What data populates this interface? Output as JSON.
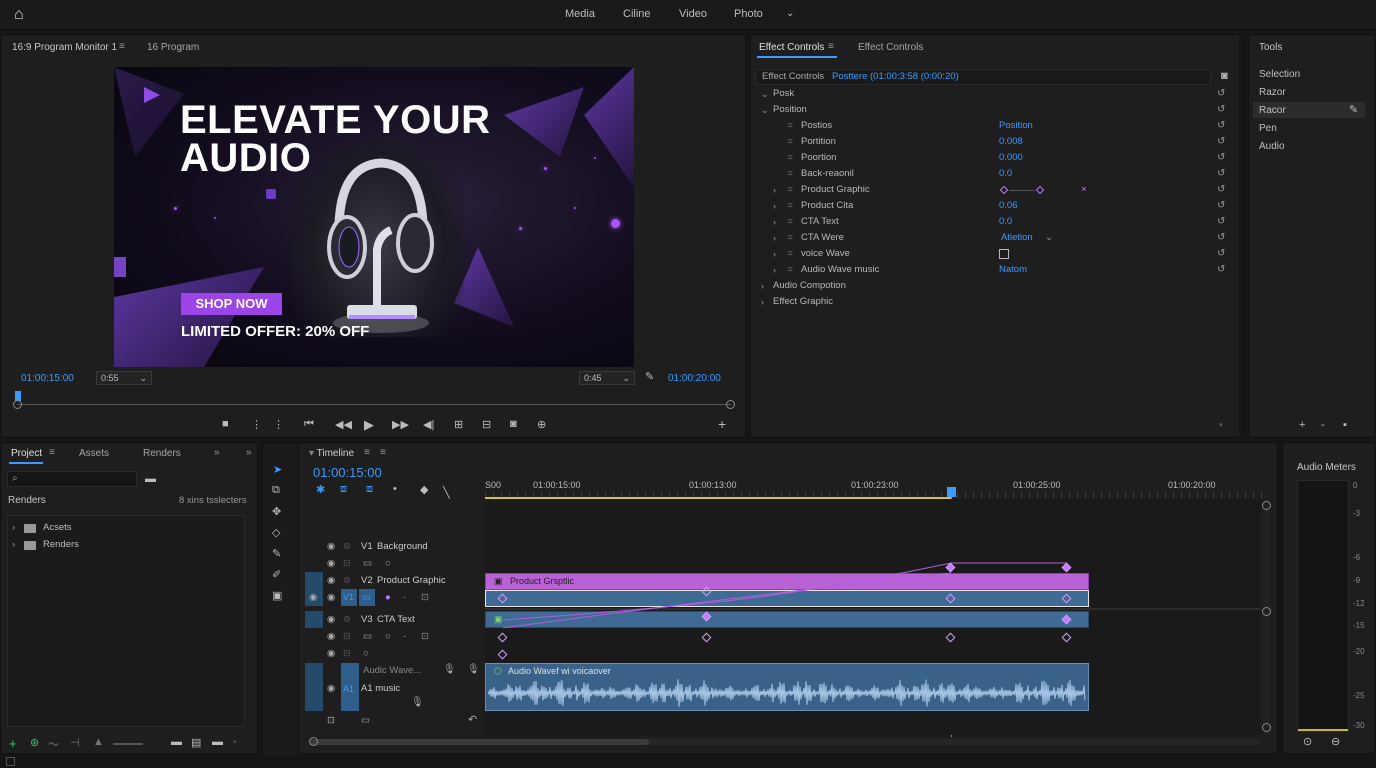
{
  "topbar": {
    "tabs": [
      "Media",
      "Ciline",
      "Video",
      "Photo"
    ]
  },
  "program_monitor": {
    "tab1": "16:9 Program Monitor 1",
    "tab2": "16 Program",
    "timecode_left": "01:00:15:00",
    "zoom_left": "0:55",
    "zoom_right": "0:45",
    "timecode_right": "01:00:20:00",
    "frame": {
      "headline_line1": "ELEVATE YOUR",
      "headline_line2": "AUDIO",
      "cta": "SHOP NOW",
      "offer": "LIMITED OFFER: 20% OFF",
      "accent_color": "#9b45e8"
    }
  },
  "effect_controls": {
    "tab1": "Effect Controls",
    "tab2": "Effect Controls",
    "header_label": "Effect Controls",
    "header_clip": "Posttere (01:00:3:58 (0:00:20)",
    "rows": [
      {
        "label": "Posk"
      },
      {
        "label": "Position"
      },
      {
        "label": "Postios",
        "value": "Position"
      },
      {
        "label": "Portition",
        "value": "0.008"
      },
      {
        "label": "Poortion",
        "value": "0.000"
      },
      {
        "label": "Back-reaonil",
        "value": "0.0"
      },
      {
        "label": "Product Graphic"
      },
      {
        "label": "Product Cita",
        "value": "0.06"
      },
      {
        "label": "CTA Text",
        "value": "0.0"
      },
      {
        "label": "CTA Were",
        "value": "Atietion"
      },
      {
        "label": "voice Wave"
      },
      {
        "label": "Audio Wave music",
        "value": "Natom"
      },
      {
        "label": "Audio Compotion"
      },
      {
        "label": "Effect Graphic"
      }
    ]
  },
  "tools": {
    "title": "Tools",
    "items": [
      "Selection",
      "Razor",
      "Racor",
      "Pen",
      "Audio"
    ]
  },
  "project": {
    "tabs": [
      "Project",
      "Assets",
      "Renders"
    ],
    "section": "Renders",
    "section_meta": "8 xins tsslecters",
    "folders": [
      "Acsets",
      "Renders"
    ]
  },
  "timeline": {
    "title": "Timeline",
    "timecode": "01:00:15:00",
    "ruler": [
      "S00",
      "01:00:15:00",
      "01:00:13:00",
      "01:00:23:00",
      "01:00:25:00",
      "01:00:20:00"
    ],
    "tracks": [
      {
        "id": "V1",
        "name": "Background"
      },
      {
        "id": "V2",
        "name": "Product Graphic"
      },
      {
        "id": "V3",
        "name": "CTA Text"
      },
      {
        "id": "A1",
        "name": "Audic Wave..."
      },
      {
        "id": "A1",
        "name": "music"
      }
    ],
    "clips": {
      "v2": "Product Grsptlic",
      "a1": "Audio Wavef wi voicaover"
    },
    "clip_colors": {
      "video": "#b862d6",
      "audio": "#3f6a93"
    }
  },
  "audio_meters": {
    "title": "Audio Meters",
    "scale": [
      "0",
      "-3",
      "-6",
      "-9",
      "-12",
      "-15",
      "-20",
      "-25",
      "-30"
    ]
  }
}
